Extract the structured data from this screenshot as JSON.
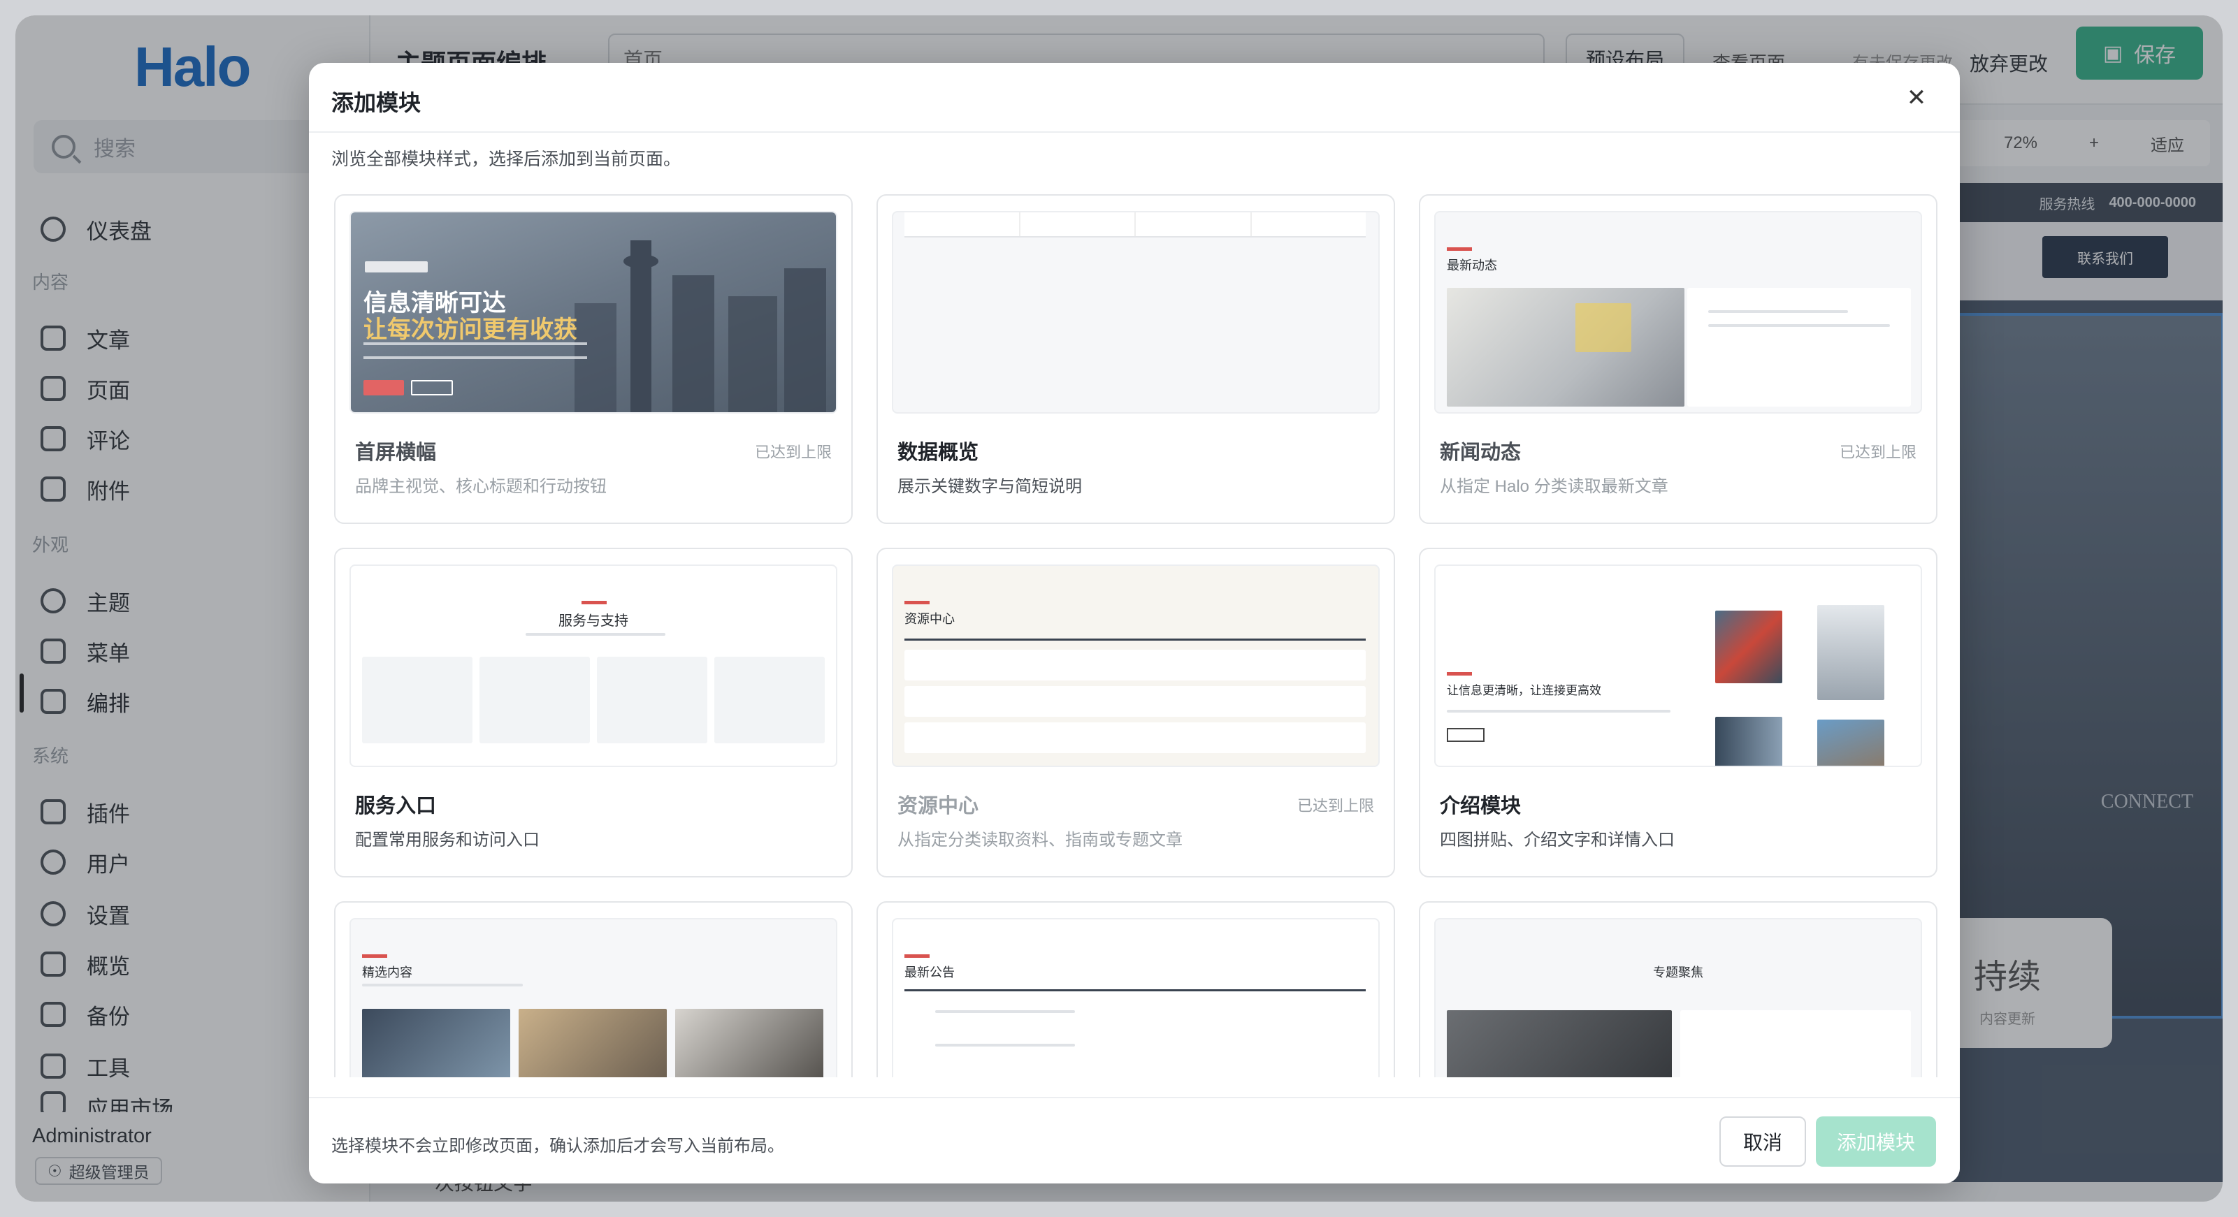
{
  "sidebar": {
    "logo": "Halo",
    "search_placeholder": "搜索",
    "items": [
      {
        "label": "仪表盘"
      },
      {
        "section": "内容"
      },
      {
        "label": "文章"
      },
      {
        "label": "页面"
      },
      {
        "label": "评论"
      },
      {
        "label": "附件"
      },
      {
        "section": "外观"
      },
      {
        "label": "主题"
      },
      {
        "label": "菜单"
      },
      {
        "label": "编排"
      },
      {
        "section": "系统"
      },
      {
        "label": "插件"
      },
      {
        "label": "用户"
      },
      {
        "label": "设置"
      },
      {
        "label": "概览"
      },
      {
        "label": "备份"
      },
      {
        "label": "工具"
      },
      {
        "label": "应用市场"
      }
    ],
    "user": "Administrator",
    "role": "超级管理员"
  },
  "topbar": {
    "title": "主题页面编排",
    "page_select": "首页",
    "preset_button": "预设布局",
    "view_page": "查看页面",
    "unsaved": "有未保存更改",
    "discard": "放弃更改",
    "save": "保存"
  },
  "canvas": {
    "zoom": "72%",
    "fit": "适应",
    "hotline_label": "服务热线",
    "hotline": "400-000-0000",
    "contact": "联系我们",
    "card_title": "持续",
    "card_sub": "内容更新",
    "bottom_text": "次按钮文字",
    "connect": "CONNECT"
  },
  "modal": {
    "title": "添加模块",
    "subtitle": "浏览全部模块样式，选择后添加到当前页面。",
    "footer_text": "选择模块不会立即修改页面，确认添加后才会写入当前布局。",
    "cancel": "取消",
    "add": "添加模块",
    "cards": [
      {
        "title": "首屏横幅",
        "desc": "品牌主视觉、核心标题和行动按钮",
        "limit": "已达到上限",
        "thumb_h1": "信息清晰可达",
        "thumb_h2": "让每次访问更有收获"
      },
      {
        "title": "数据概览",
        "desc": "展示关键数字与简短说明",
        "limit": ""
      },
      {
        "title": "新闻动态",
        "desc": "从指定 Halo 分类读取最新文章",
        "limit": "已达到上限",
        "thumb_h": "最新动态"
      },
      {
        "title": "服务入口",
        "desc": "配置常用服务和访问入口",
        "limit": "",
        "thumb_h": "服务与支持"
      },
      {
        "title": "资源中心",
        "desc": "从指定分类读取资料、指南或专题文章",
        "limit": "已达到上限",
        "thumb_h": "资源中心"
      },
      {
        "title": "介绍模块",
        "desc": "四图拼贴、介绍文字和详情入口",
        "limit": "",
        "thumb_h": "让信息更清晰，让连接更高效"
      },
      {
        "title": "",
        "desc": "",
        "limit": "",
        "thumb_h": "精选内容"
      },
      {
        "title": "",
        "desc": "",
        "limit": "",
        "thumb_h": "最新公告"
      },
      {
        "title": "",
        "desc": "",
        "limit": "",
        "thumb_h": "专题聚焦"
      }
    ]
  }
}
